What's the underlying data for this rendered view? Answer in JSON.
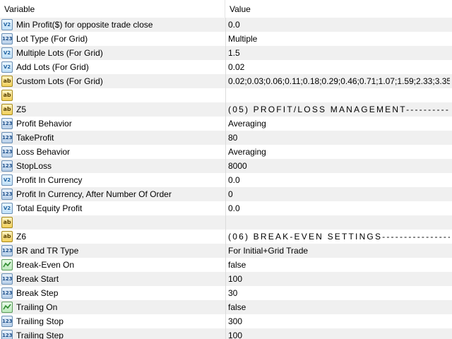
{
  "header": {
    "variable": "Variable",
    "value": "Value"
  },
  "rows": [
    {
      "icon": "frac",
      "name": "Min Profit($) for opposite trade close",
      "value": "0.0"
    },
    {
      "icon": "num",
      "name": "Lot Type (For Grid)",
      "value": "Multiple"
    },
    {
      "icon": "frac",
      "name": "Multiple Lots (For Grid)",
      "value": "1.5"
    },
    {
      "icon": "frac",
      "name": "Add Lots (For Grid)",
      "value": "0.02"
    },
    {
      "icon": "ab",
      "name": "Custom Lots (For Grid)",
      "value": "0.02;0.03;0.06;0.11;0.18;0.29;0.46;0.71;1.07;1.59;2.33;3.35"
    },
    {
      "icon": "ab",
      "name": "",
      "value": ""
    },
    {
      "icon": "ab",
      "name": "Z5",
      "value": "(05) PROFIT/LOSS MANAGEMENT--------------------..."
    },
    {
      "icon": "num",
      "name": "Profit Behavior",
      "value": "Averaging"
    },
    {
      "icon": "num",
      "name": "TakeProfit",
      "value": "80"
    },
    {
      "icon": "num",
      "name": "Loss Behavior",
      "value": "Averaging"
    },
    {
      "icon": "num",
      "name": "StopLoss",
      "value": "8000"
    },
    {
      "icon": "frac",
      "name": "Profit In Currency",
      "value": "0.0"
    },
    {
      "icon": "num",
      "name": "Profit In Currency, After Number Of Order",
      "value": "0"
    },
    {
      "icon": "frac",
      "name": "Total Equity Profit",
      "value": "0.0"
    },
    {
      "icon": "ab",
      "name": "",
      "value": ""
    },
    {
      "icon": "ab",
      "name": "Z6",
      "value": "(06) BREAK-EVEN SETTINGS-------------------------------..."
    },
    {
      "icon": "num",
      "name": "BR and TR Type",
      "value": "For Initial+Grid Trade"
    },
    {
      "icon": "bool",
      "name": "Break-Even On",
      "value": "false"
    },
    {
      "icon": "num",
      "name": "Break Start",
      "value": "100"
    },
    {
      "icon": "num",
      "name": "Break Step",
      "value": "30"
    },
    {
      "icon": "bool",
      "name": "Trailing On",
      "value": "false"
    },
    {
      "icon": "num",
      "name": "Trailing Stop",
      "value": "300"
    },
    {
      "icon": "num",
      "name": "Trailing Step",
      "value": "100"
    }
  ],
  "icon_labels": {
    "frac": "V2",
    "num": "123",
    "ab": "ab",
    "bool": ""
  },
  "colors": {
    "row_alt": "#f0f0f0",
    "row_white": "#ffffff",
    "grid_line": "#dcdcdc"
  }
}
